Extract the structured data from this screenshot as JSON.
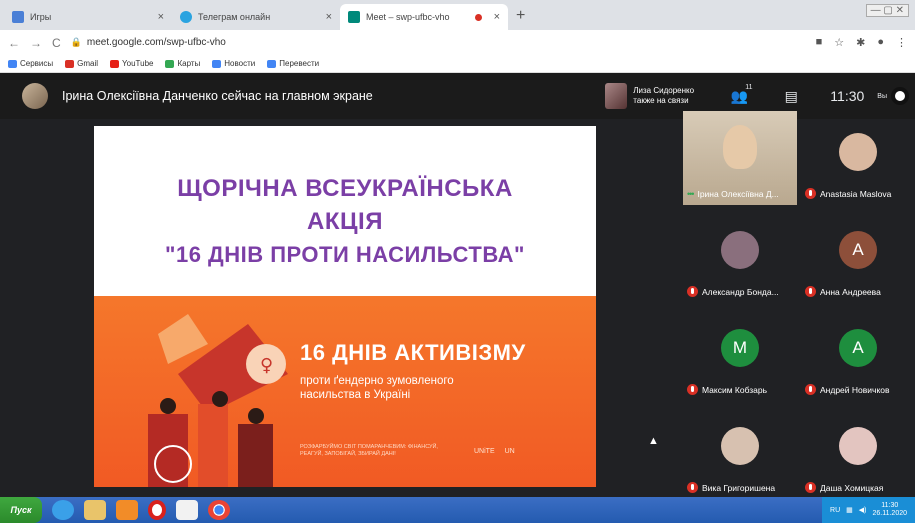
{
  "browser": {
    "tabs": [
      {
        "title": "Игры",
        "active": false,
        "favicon_color": "#4a7fd6"
      },
      {
        "title": "Телеграм онлайн",
        "active": false,
        "favicon_color": "#2aa3e0"
      },
      {
        "title": "Meet – swp-ufbc-vho",
        "active": true,
        "favicon_color": "#00897b"
      }
    ],
    "url": "meet.google.com/swp-ufbc-vho",
    "bookmarks": [
      {
        "label": "Сервисы",
        "color": "#4285f4"
      },
      {
        "label": "Gmail",
        "color": "#d93025"
      },
      {
        "label": "YouTube",
        "color": "#e62117"
      },
      {
        "label": "Карты",
        "color": "#34a853"
      },
      {
        "label": "Новости",
        "color": "#4285f4"
      },
      {
        "label": "Перевести",
        "color": "#4285f4"
      }
    ]
  },
  "meet": {
    "presenter_text": "Ірина Олексіївна Данченко сейчас на главном экране",
    "also_on_call": {
      "name": "Лиза Сидоренко",
      "text": "также на связи"
    },
    "participant_count": "11",
    "time": "11:30",
    "me_label": "Вы",
    "slide": {
      "title_lines": [
        "ЩОРІЧНА ВСЕУКРАЇНСЬКА",
        "АКЦІЯ",
        "\"16 ДНІВ ПРОТИ НАСИЛЬСТВА\""
      ],
      "banner_heading": "16 ДНІВ АКТИВІЗМУ",
      "banner_sub": "проти ґендерно зумовленого насильства в Україні",
      "banner_foot": "РОЗФАРБУЙМО СВІТ ПОМАРАНЧЕВИМ: ФІНАНСУЙ, РЕАГУЙ, ЗАПОБІГАЙ, ЗБИРАЙ ДАНІ!",
      "logos": [
        "UNiTE",
        "UN"
      ]
    },
    "participants": [
      {
        "name": "Ірина Олексіївна Д...",
        "video": true,
        "muted": false,
        "avatar_letter": "",
        "avatar_color": "#c7b296"
      },
      {
        "name": "Anastasia Maslova",
        "video": false,
        "muted": true,
        "avatar_letter": "",
        "avatar_color": "#d9b8a0"
      },
      {
        "name": "Александр Бонда...",
        "video": false,
        "muted": true,
        "avatar_letter": "",
        "avatar_color": "#8a6f7d"
      },
      {
        "name": "Анна Андреева",
        "video": false,
        "muted": true,
        "avatar_letter": "A",
        "avatar_color": "#8d4f3a"
      },
      {
        "name": "Максим Кобзарь",
        "video": false,
        "muted": true,
        "avatar_letter": "M",
        "avatar_color": "#1e8e3e"
      },
      {
        "name": "Андрей Новичков",
        "video": false,
        "muted": true,
        "avatar_letter": "A",
        "avatar_color": "#1e8e3e"
      },
      {
        "name": "Вика Григоришена",
        "video": false,
        "muted": true,
        "avatar_letter": "",
        "avatar_color": "#d7c1b0"
      },
      {
        "name": "Даша Хомицкая",
        "video": false,
        "muted": true,
        "avatar_letter": "",
        "avatar_color": "#e3c5c0"
      }
    ]
  },
  "taskbar": {
    "start_label": "Пуск",
    "lang": "RU",
    "clock_time": "11:30",
    "clock_date": "26.11.2020"
  }
}
